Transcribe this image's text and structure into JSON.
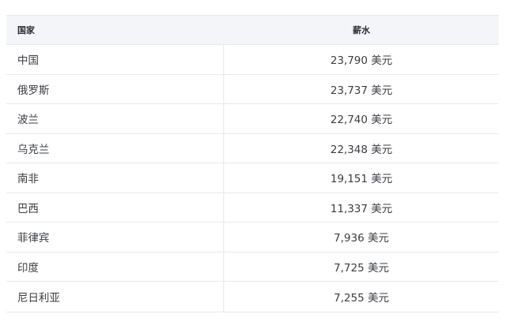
{
  "table": {
    "header": {
      "country": "国家",
      "salary": "薪水"
    },
    "rows": [
      {
        "country": "中国",
        "salary": "23,790 美元"
      },
      {
        "country": "俄罗斯",
        "salary": "23,737 美元"
      },
      {
        "country": "波兰",
        "salary": "22,740 美元"
      },
      {
        "country": "乌克兰",
        "salary": "22,348 美元"
      },
      {
        "country": "南非",
        "salary": "19,151 美元"
      },
      {
        "country": "巴西",
        "salary": "11,337 美元"
      },
      {
        "country": "菲律宾",
        "salary": "7,936 美元"
      },
      {
        "country": "印度",
        "salary": "7,725 美元"
      },
      {
        "country": "尼日利亚",
        "salary": "7,255 美元"
      }
    ]
  }
}
